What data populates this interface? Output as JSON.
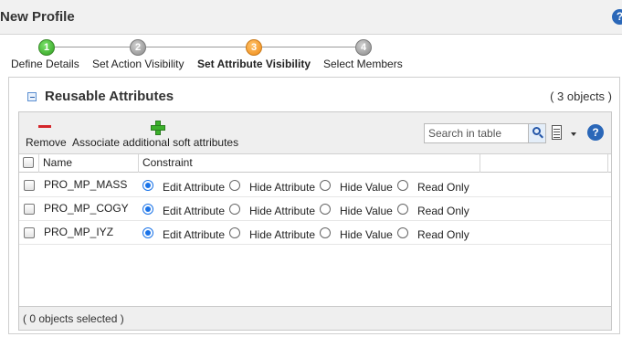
{
  "window": {
    "title": "New Profile"
  },
  "wizard": {
    "steps": [
      {
        "number": "1",
        "label": "Define Details",
        "state": "complete"
      },
      {
        "number": "2",
        "label": "Set Action Visibility",
        "state": "pending"
      },
      {
        "number": "3",
        "label": "Set Attribute Visibility",
        "state": "active"
      },
      {
        "number": "4",
        "label": "Select Members",
        "state": "pending"
      }
    ]
  },
  "section": {
    "title": "Reusable Attributes",
    "count": "( 3 objects )"
  },
  "toolbar": {
    "remove_label": "Remove",
    "associate_label": "Associate additional soft attributes",
    "search_placeholder": "Search in table"
  },
  "table": {
    "columns": [
      "Name",
      "Constraint"
    ],
    "options": [
      "Edit Attribute",
      "Hide Attribute",
      "Hide Value",
      "Read Only"
    ],
    "rows": [
      {
        "name": "PRO_MP_MASS",
        "selected_option": "Edit Attribute"
      },
      {
        "name": "PRO_MP_COGY",
        "selected_option": "Edit Attribute"
      },
      {
        "name": "PRO_MP_IYZ",
        "selected_option": "Edit Attribute"
      }
    ]
  },
  "footer": {
    "selection_status": "( 0 objects selected )"
  },
  "colors": {
    "accent": "#2a67b8",
    "remove": "#d4252a",
    "add": "#3bb02a",
    "step_active": "#f08a16",
    "step_complete": "#2f9f1f"
  }
}
